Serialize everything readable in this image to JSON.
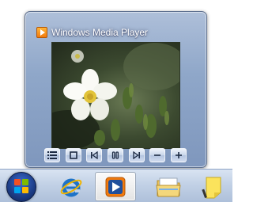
{
  "thumbnail": {
    "title": "Windows Media Player",
    "app_icon": "wmp-play-icon",
    "toolbar_buttons": [
      {
        "name": "now-playing-list",
        "icon": "list-icon"
      },
      {
        "name": "stop",
        "icon": "stop-icon"
      },
      {
        "name": "previous",
        "icon": "previous-track-icon"
      },
      {
        "name": "pause",
        "icon": "pause-icon"
      },
      {
        "name": "next",
        "icon": "next-track-icon"
      },
      {
        "name": "volume-down",
        "icon": "minus-icon"
      },
      {
        "name": "volume-up",
        "icon": "plus-icon"
      }
    ]
  },
  "taskbar": {
    "items": [
      {
        "name": "start-button",
        "icon": "windows-logo-icon"
      },
      {
        "name": "internet-explorer",
        "icon": "internet-explorer-icon"
      },
      {
        "name": "windows-media-player",
        "icon": "media-player-icon",
        "active": true
      },
      {
        "name": "windows-explorer",
        "icon": "folder-icon"
      },
      {
        "name": "sticky-notes",
        "icon": "sticky-note-icon"
      }
    ]
  },
  "colors": {
    "glass": "#8fa7c9",
    "taskbar": "#c2d1e6",
    "media_orange": "#f27a0c"
  }
}
